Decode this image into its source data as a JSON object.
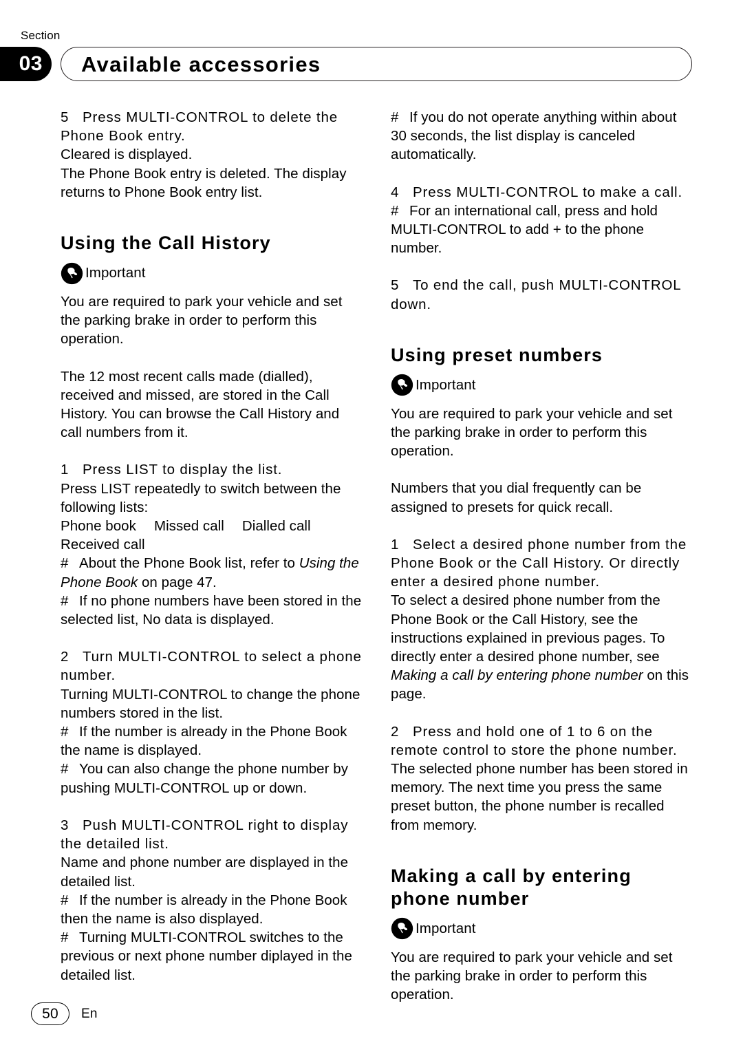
{
  "header": {
    "section_label": "Section",
    "section_number": "03",
    "title": "Available accessories"
  },
  "footer": {
    "page_number": "50",
    "language_code": "En"
  },
  "icons": {
    "important": "pushpin-icon"
  },
  "labels": {
    "important": "Important"
  },
  "left_column": {
    "step5_heading": "Press MULTI-CONTROL to delete the Phone Book entry.",
    "step5_num": "5",
    "step5_body1": "Cleared is displayed.",
    "step5_body2": "The Phone Book entry is deleted. The display returns to Phone Book entry list.",
    "heading_call_history": "Using the Call History",
    "important_text_1": "You are required to park your vehicle and set the parking brake in order to perform this operation.",
    "intro_text": "The 12 most recent calls made (dialled), received and missed, are stored in the Call History. You can browse the Call History and call numbers from it.",
    "step1_num": "1",
    "step1_heading": "Press LIST to display the list.",
    "step1_body": "Press LIST repeatedly to switch between the following lists:",
    "list_items": [
      "Phone book",
      "Missed call",
      "Dialled call",
      "Received call"
    ],
    "note1_a": "About the Phone Book list, refer to ",
    "note1_italic": "Using the Phone Book",
    "note1_b": " on page 47.",
    "note2": "If no phone numbers have been stored in the selected list, No data is displayed.",
    "step2_num": "2",
    "step2_heading": "Turn MULTI-CONTROL to select a phone number.",
    "step2_body": "Turning MULTI-CONTROL to change the phone numbers stored in the list.",
    "note3": "If the number is already in the Phone Book the name is displayed.",
    "note4": "You can also change the phone number by pushing MULTI-CONTROL up or down.",
    "step3_num": "3",
    "step3_heading": "Push MULTI-CONTROL right to display the detailed list.",
    "step3_body": "Name and phone number are displayed in the detailed list.",
    "note5": "If the number is already in the Phone Book then the name is also displayed.",
    "note6": "Turning MULTI-CONTROL switches to the previous or next phone number diplayed in the detailed list.",
    "hash": "#"
  },
  "right_column": {
    "note_top": "If you do not operate anything within about 30 seconds, the list display is canceled automatically.",
    "step4_num": "4",
    "step4_heading": "Press MULTI-CONTROL to make a call.",
    "note_intl": "For an international call, press and hold MULTI-CONTROL to add + to the phone number.",
    "step5_num": "5",
    "step5_heading": "To end the call, push MULTI-CONTROL down.",
    "heading_preset": "Using preset numbers",
    "important_text_2": "You are required to park your vehicle and set the parking brake in order to perform this operation.",
    "preset_intro": "Numbers that you dial frequently can be assigned to presets for quick recall.",
    "step1_num": "1",
    "step1_heading": "Select a desired phone number from the Phone Book or the Call History. Or directly enter a desired phone number.",
    "step1_body_a": "To select a desired phone number from the Phone Book or the Call History, see the instructions explained in previous pages. To directly enter a desired phone number, see ",
    "step1_body_italic": "Making a call by entering phone number",
    "step1_body_b": " on this page.",
    "step2_num": "2",
    "step2_heading": "Press and hold one of 1 to 6 on the remote control to store the phone number.",
    "step2_body": "The selected phone number has been stored in memory. The next time you press the same preset button, the phone number is recalled from memory.",
    "heading_making_call": "Making a call by entering phone number",
    "important_text_3": "You are required to park your vehicle and set the parking brake in order to perform this operation.",
    "hash": "#"
  }
}
